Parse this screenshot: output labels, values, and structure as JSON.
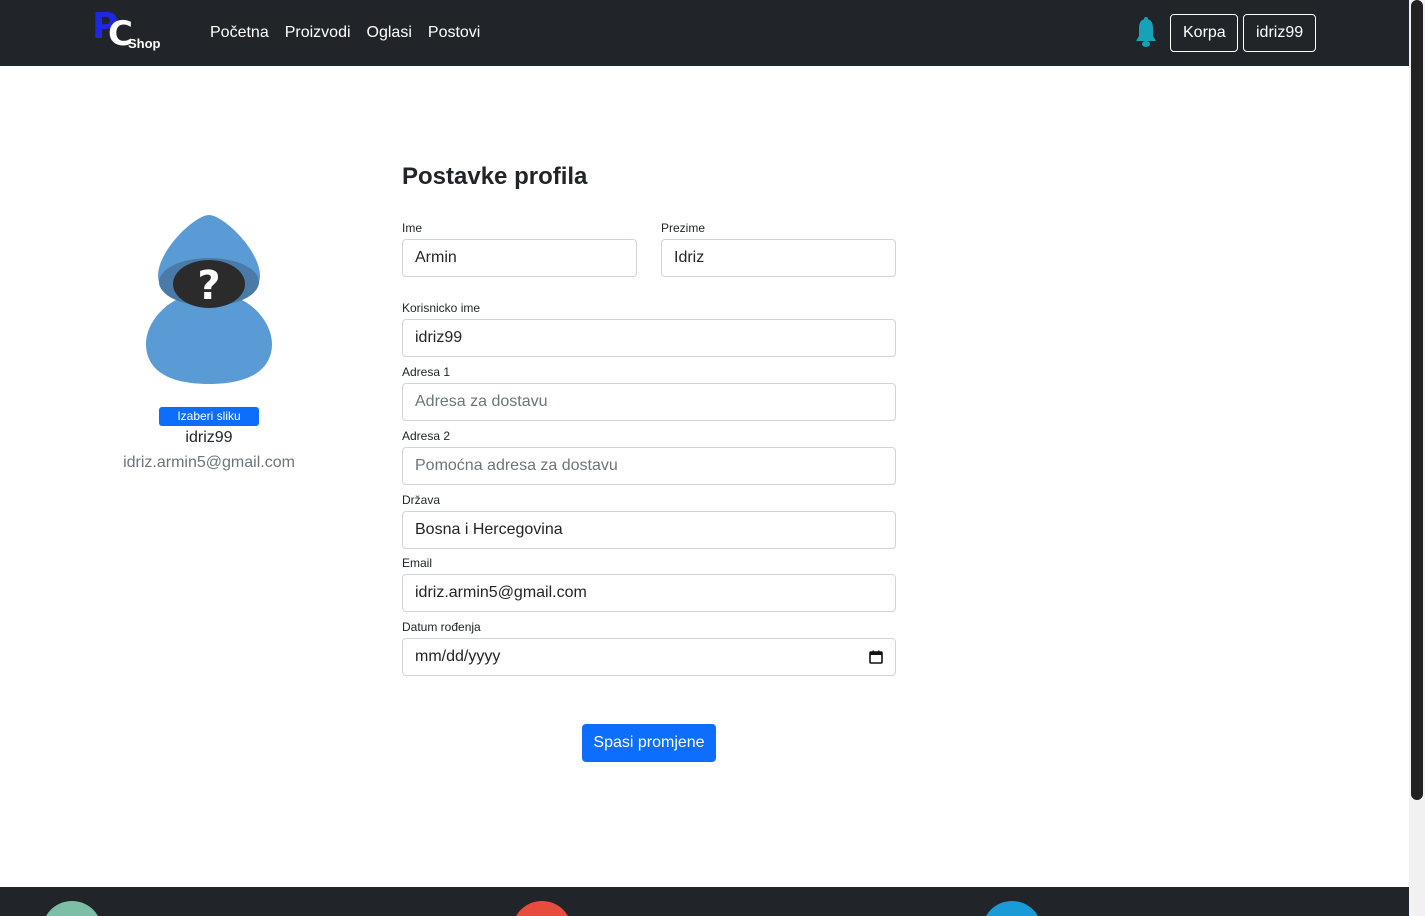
{
  "brand": {
    "letter_p": "P",
    "letter_c": "C",
    "shop": "Shop"
  },
  "nav": {
    "links": [
      "Početna",
      "Proizvodi",
      "Oglasi",
      "Postovi"
    ]
  },
  "header": {
    "cart_label": "Korpa",
    "user_label": "idriz99"
  },
  "sidebar": {
    "choose_image_label": "Izaberi sliku",
    "username": "idriz99",
    "email": "idriz.armin5@gmail.com"
  },
  "form": {
    "title": "Postavke profila",
    "first_name": {
      "label": "Ime",
      "value": "Armin"
    },
    "last_name": {
      "label": "Prezime",
      "value": "Idriz"
    },
    "username": {
      "label": "Korisnicko ime",
      "value": "idriz99"
    },
    "address1": {
      "label": "Adresa 1",
      "placeholder": "Adresa za dostavu"
    },
    "address2": {
      "label": "Adresa 2",
      "placeholder": "Pomoćna adresa za dostavu"
    },
    "country": {
      "label": "Država",
      "value": "Bosna i Hercegovina"
    },
    "email": {
      "label": "Email",
      "value": "idriz.armin5@gmail.com"
    },
    "birth_date": {
      "label": "Datum rođenja",
      "placeholder": "mm/dd/yyyy"
    },
    "save_label": "Spasi promjene"
  },
  "icons": {
    "bell": "bell-icon",
    "avatar": "unknown-user-avatar",
    "calendar": "calendar-icon",
    "footer": [
      "whatsapp-icon",
      "gmail-icon",
      "telegram-icon"
    ]
  },
  "colors": {
    "navbar": "#212529",
    "primary": "#0d6efd",
    "brand_blue": "#1d28e0",
    "avatar_blue": "#5b9bd5",
    "bell": "#17a2b8",
    "footer_green": "#7cbfa6",
    "footer_red": "#e74c3c",
    "footer_blue": "#1a9ad6"
  }
}
